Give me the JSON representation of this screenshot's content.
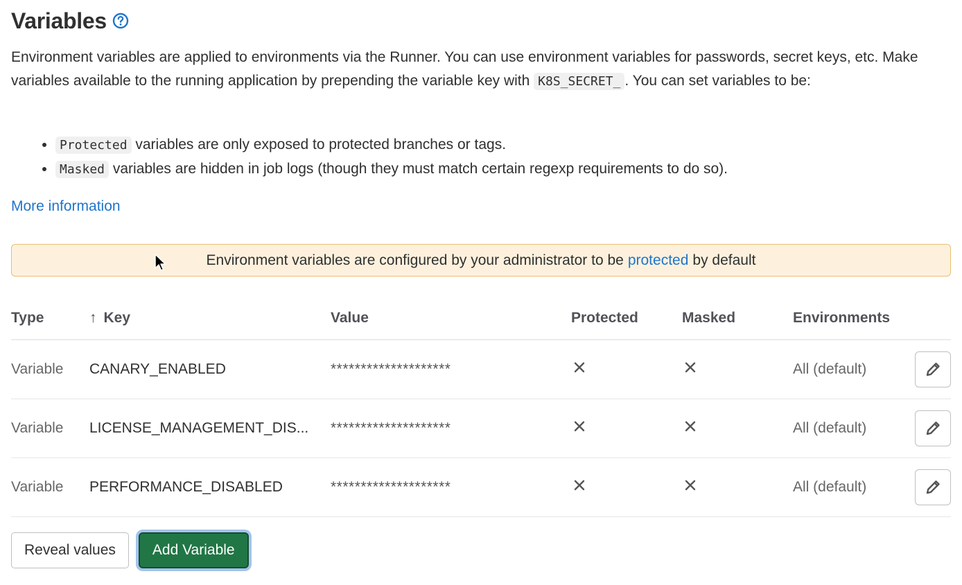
{
  "header": {
    "title": "Variables",
    "help_icon": "question-circle-icon"
  },
  "description": {
    "text_1": "Environment variables are applied to environments via the Runner. You can use environment variables for passwords, secret keys, etc. Make variables available to the running application by prepending the variable key with ",
    "code_prefix": "K8S_SECRET_",
    "text_2": ". You can set variables to be:"
  },
  "bullets": [
    {
      "code": "Protected",
      "text": " variables are only exposed to protected branches or tags."
    },
    {
      "code": "Masked",
      "text": " variables are hidden in job logs (though they must match certain regexp requirements to do so)."
    }
  ],
  "more_info_link": "More information",
  "banner": {
    "text_before": "Environment variables are configured by your administrator to be",
    "link": "protected",
    "text_after": "by default",
    "bg_color": "#fdf1dd",
    "border_color": "#e9be74"
  },
  "table": {
    "columns": {
      "type": "Type",
      "key": "Key",
      "key_sort_icon": "arrow-up-icon",
      "value": "Value",
      "protected": "Protected",
      "masked": "Masked",
      "environments": "Environments"
    },
    "rows": [
      {
        "type": "Variable",
        "key": "CANARY_ENABLED",
        "value": "********************",
        "protected": false,
        "masked": false,
        "environments": "All (default)"
      },
      {
        "type": "Variable",
        "key": "LICENSE_MANAGEMENT_DIS...",
        "value": "********************",
        "protected": false,
        "masked": false,
        "environments": "All (default)"
      },
      {
        "type": "Variable",
        "key": "PERFORMANCE_DISABLED",
        "value": "********************",
        "protected": false,
        "masked": false,
        "environments": "All (default)"
      }
    ]
  },
  "actions": {
    "reveal_label": "Reveal values",
    "add_label": "Add Variable",
    "add_color": "#217645"
  },
  "colors": {
    "link": "#1f75cb",
    "text": "#303030"
  }
}
